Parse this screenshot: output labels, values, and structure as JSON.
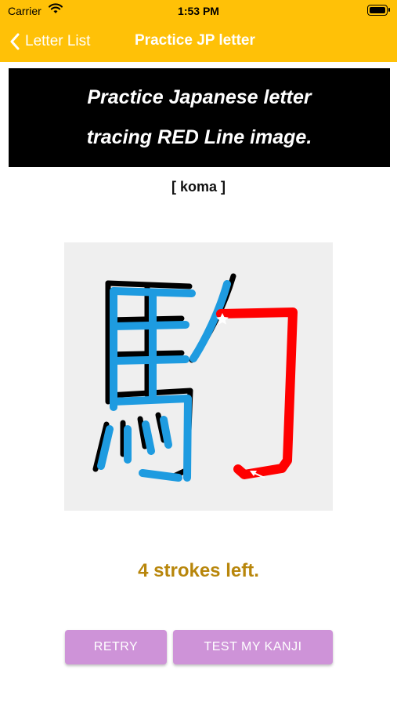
{
  "status_bar": {
    "carrier": "Carrier",
    "time": "1:53 PM"
  },
  "nav": {
    "back_label": "Letter List",
    "title": "Practice JP letter"
  },
  "banner": {
    "line1": "Practice Japanese letter",
    "line2": "tracing RED Line image."
  },
  "reading": "[ koma ]",
  "tracing": {
    "kanji": "駒",
    "completed_color": "#1E9BE0",
    "guide_color": "#FF0000",
    "outline_color": "#000000"
  },
  "status": {
    "strokes_left": "4 strokes left."
  },
  "buttons": {
    "retry": "RETRY",
    "test": "TEST MY KANJI"
  },
  "colors": {
    "header": "#FFC107",
    "button": "#CE93D8",
    "status_text": "#B8860B"
  }
}
